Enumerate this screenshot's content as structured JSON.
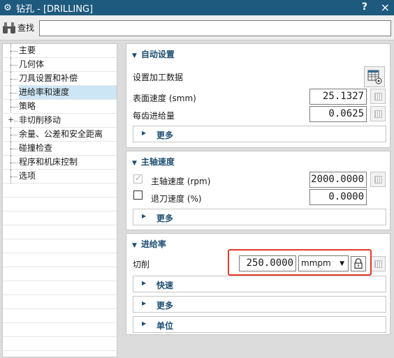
{
  "window": {
    "title": "钻孔 - [DRILLING]",
    "help": "?",
    "close": "×"
  },
  "find": {
    "label": "查找",
    "value": ""
  },
  "tree": [
    {
      "label": "主要",
      "expandable": false,
      "selected": false
    },
    {
      "label": "几何体",
      "expandable": false,
      "selected": false
    },
    {
      "label": "刀具设置和补偿",
      "expandable": false,
      "selected": false
    },
    {
      "label": "进给率和速度",
      "expandable": false,
      "selected": true
    },
    {
      "label": "策略",
      "expandable": false,
      "selected": false
    },
    {
      "label": "非切削移动",
      "expandable": true,
      "selected": false
    },
    {
      "label": "余量、公差和安全距离",
      "expandable": false,
      "selected": false
    },
    {
      "label": "碰撞检查",
      "expandable": false,
      "selected": false
    },
    {
      "label": "程序和机床控制",
      "expandable": false,
      "selected": false
    },
    {
      "label": "选项",
      "expandable": false,
      "selected": false
    }
  ],
  "auto": {
    "title": "自动设置",
    "set_label": "设置加工数据",
    "surface_speed_label": "表面速度 (smm)",
    "surface_speed_value": "25.1327",
    "feed_per_tooth_label": "每齿进给量",
    "feed_per_tooth_value": "0.0625",
    "more": "更多"
  },
  "spindle": {
    "title": "主轴速度",
    "speed_label": "主轴速度 (rpm)",
    "speed_value": "2000.0000",
    "retract_label": "退刀速度 (%)",
    "retract_value": "0.0000",
    "more": "更多"
  },
  "feed": {
    "title": "进给率",
    "cut_label": "切削",
    "cut_value": "250.0000",
    "unit_value": "mmpm",
    "rapid": "快速",
    "more": "更多",
    "units": "单位"
  },
  "colors": {
    "titlebar": "#1e5a7e",
    "accent": "#1c4e73",
    "highlight": "#e03a2a",
    "selected": "#cce6f5"
  }
}
